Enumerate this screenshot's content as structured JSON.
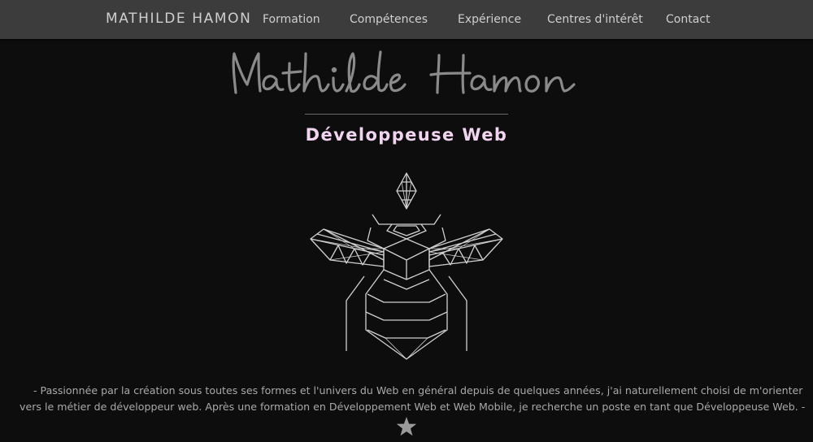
{
  "navbar": {
    "brand": "MATHILDE HAMON",
    "links": [
      "Formation",
      "Compétences",
      "Expérience",
      "Centres d'intérêt",
      "Contact"
    ]
  },
  "hero": {
    "signature": "Mathilde Hamon",
    "subtitle": "Développeuse Web",
    "logo_icon": "geometric-bee-icon",
    "accent_color": "#f1d4ef"
  },
  "about": {
    "text": "- Passionnée par la création sous toutes ses formes et l'univers du Web en général depuis de quelques années, j'ai naturellement choisi de m'orienter vers le métier de développeur web. Après une formation en Développement Web et Web Mobile, je recherche un poste en tant que Développeuse Web. -",
    "divider_icon": "star-icon"
  }
}
